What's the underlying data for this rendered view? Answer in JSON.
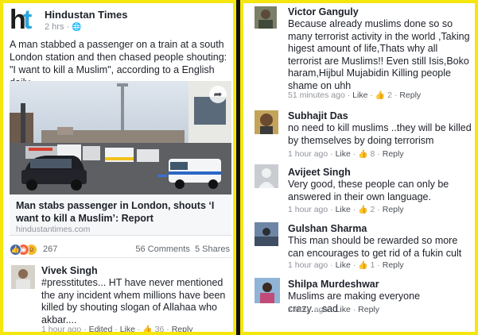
{
  "post": {
    "page_name": "Hindustan Times",
    "time": "2 hrs",
    "text": "A man stabbed a passenger on a train at a south London station and then chased people shouting: \"I want to kill a Muslim\", according to a English daily.",
    "link_title": "Man stabs passenger in London, shouts ‘I want to kill a Muslim’: Report",
    "link_domain": "hindustantimes.com",
    "reaction_count": "267",
    "comments_count": "56 Comments",
    "shares_count": "5 Shares"
  },
  "comments": [
    {
      "name": "Vivek Singh",
      "text": "#presstitutes... HT have never mentioned the any incident whem millions have been killed by shouting slogan of Allahaa who akbar....",
      "time": "1 hour ago",
      "edited": "Edited",
      "like": "Like",
      "likes": "36",
      "reply": "Reply"
    },
    {
      "name": "Victor Ganguly",
      "text": "Because already muslims done so so many terrorist activity in the world ,Taking higest amount of life,Thats why all terrorist are Muslims!! Even still Isis,Boko haram,Hijbul Mujabidin Killing people shame on uhh",
      "time": "51 minutes ago",
      "like": "Like",
      "likes": "2",
      "reply": "Reply"
    },
    {
      "name": "Subhajit Das",
      "text": "no need to kill muslims ..they will be killed by themselves by doing terrorism",
      "time": "1 hour ago",
      "like": "Like",
      "likes": "8",
      "reply": "Reply"
    },
    {
      "name": "Avijeet Singh",
      "text": "Very good, these people can only be answered in their own language.",
      "time": "1 hour ago",
      "like": "Like",
      "likes": "2",
      "reply": "Reply"
    },
    {
      "name": "Gulshan Sharma",
      "text": "This man should be rewarded so more can encourages to get rid of a fukin cult",
      "time": "1 hour ago",
      "like": "Like",
      "likes": "1",
      "reply": "Reply"
    },
    {
      "name": "Shilpa Murdeshwar",
      "text": "Muslims are making everyone crazy....sad",
      "time": "1 hour ago",
      "like": "Like",
      "reply": "Reply"
    }
  ],
  "icons": {
    "globe": "globe-icon",
    "share": "share-icon",
    "like": "thumbs-up-icon"
  },
  "colors": {
    "frame": "#f5e60d",
    "ht_blue": "#2aa7df",
    "meta_gray": "#90949c"
  }
}
